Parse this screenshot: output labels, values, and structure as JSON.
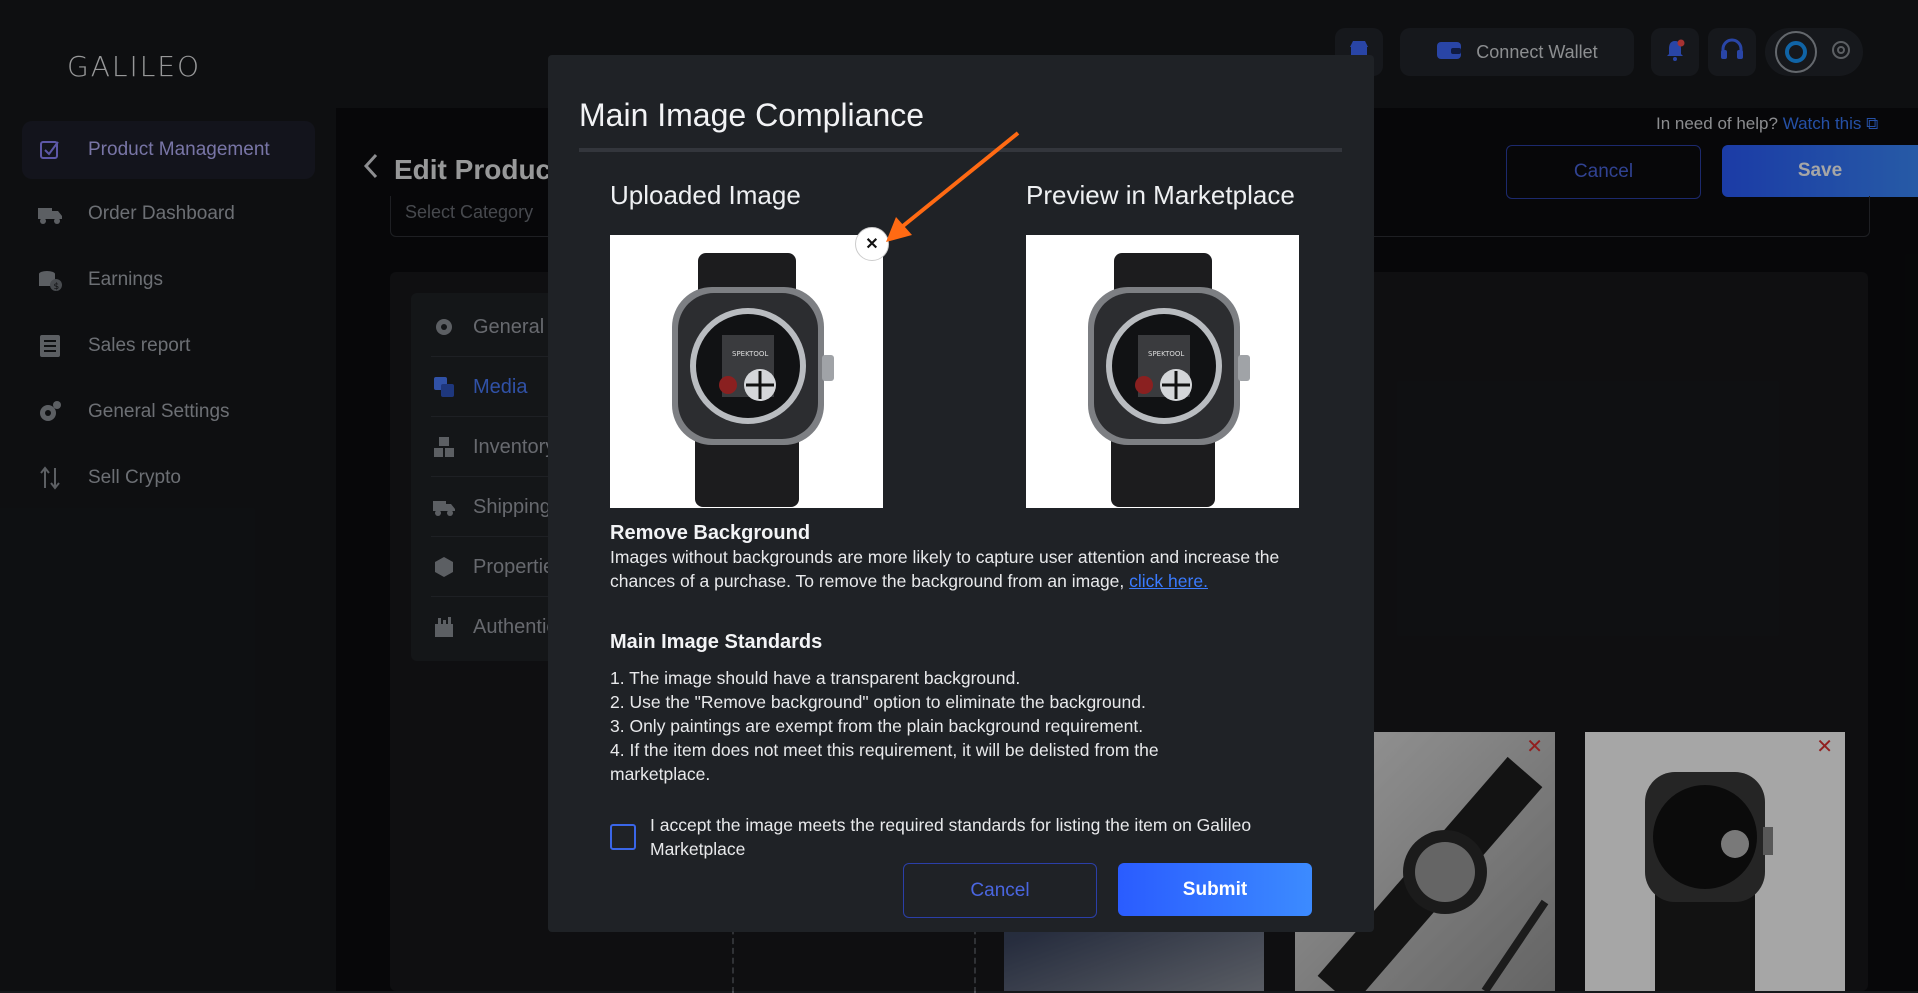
{
  "app": {
    "logo": "GALILEO"
  },
  "sidebar": {
    "items": [
      {
        "label": "Product Management",
        "icon": "checkbox-icon",
        "active": true
      },
      {
        "label": "Order Dashboard",
        "icon": "truck-icon"
      },
      {
        "label": "Earnings",
        "icon": "coins-icon"
      },
      {
        "label": "Sales report",
        "icon": "report-icon"
      },
      {
        "label": "General Settings",
        "icon": "gear-icon"
      },
      {
        "label": "Sell Crypto",
        "icon": "transfer-arrows-icon"
      }
    ]
  },
  "topbar": {
    "connect_wallet": "Connect Wallet"
  },
  "page": {
    "title": "Edit Product",
    "help_text": "In need of help?",
    "help_link": "Watch this",
    "cancel": "Cancel",
    "save": "Save",
    "category_placeholder": "Select Category",
    "tabs": [
      {
        "label": "General",
        "icon": "gear-icon"
      },
      {
        "label": "Media",
        "icon": "media-icon",
        "active": true
      },
      {
        "label": "Inventory",
        "icon": "boxes-icon"
      },
      {
        "label": "Shipping",
        "icon": "truck-icon"
      },
      {
        "label": "Properties",
        "icon": "properties-icon"
      },
      {
        "label": "Authenticity",
        "icon": "certificate-icon"
      }
    ]
  },
  "modal": {
    "title": "Main Image Compliance",
    "uploaded_heading": "Uploaded Image",
    "preview_heading": "Preview in Marketplace",
    "remove_bg_heading": "Remove Background",
    "remove_bg_text": "Images without backgrounds are more likely to capture user attention and increase the chances of a purchase. To remove the background from an image,",
    "remove_bg_link": "click here.",
    "standards_heading": "Main Image Standards",
    "standards": [
      "1. The image should have a transparent background.",
      "2. Use the \"Remove background\" option to eliminate the background.",
      "3. Only paintings are exempt from the plain background requirement.",
      "4. If the item does not meet this requirement, it will be delisted from the marketplace."
    ],
    "accept_label": "I accept the image meets the required standards for listing the item on Galileo Marketplace",
    "accept_checked": false,
    "cancel": "Cancel",
    "submit": "Submit",
    "watch_brand_text": "SPEKTOOL"
  },
  "colors": {
    "accent": "#2a5cff",
    "annotation_arrow": "#ff6a13",
    "active_nav": "#b9b4ff",
    "remove_x": "#e03030"
  }
}
